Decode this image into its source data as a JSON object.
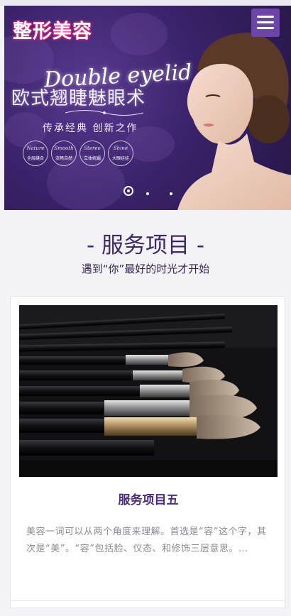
{
  "header": {
    "logo_text": "整形美容",
    "menu_icon": "hamburger-menu-icon"
  },
  "banner": {
    "headline_en": "Double eyelid",
    "headline_cn": "欧式翘睫魅眼术",
    "tagline": "传承经典 创新之作",
    "badges": [
      {
        "script": "Nature",
        "label": "全层缝合"
      },
      {
        "script": "Smooth",
        "label": "流畅自然"
      },
      {
        "script": "Stereo",
        "label": "立体妩媚"
      },
      {
        "script": "Shine",
        "label": "大眼娃娃"
      }
    ],
    "slides_total": 3,
    "active_slide": 1
  },
  "services": {
    "title": "- 服务项目 -",
    "subtitle": "遇到“你”最好的时光才开始",
    "card": {
      "title": "服务项目五",
      "description": "美容一词可以从两个角度来理解。首选是“容”这个字，其次是“美”。“容”包括脸、仪态、和修饰三层意思。…"
    }
  },
  "colors": {
    "hero_bg": "#3a236b",
    "menu_button": "#6b45a8",
    "accent_purple": "#4b2c7d",
    "logo_glow": "#ff2a8a"
  }
}
